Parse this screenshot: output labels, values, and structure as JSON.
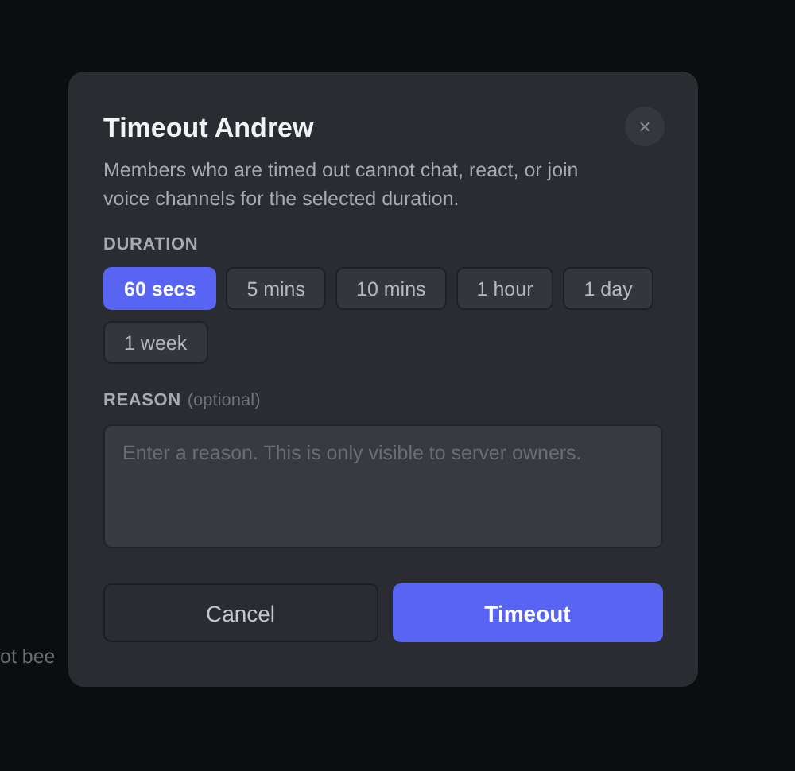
{
  "background_text": "ot bee",
  "dialog": {
    "title": "Timeout Andrew",
    "close": "×",
    "description": "Members who are timed out cannot chat, react, or join voice channels for the selected duration.",
    "duration_label": "DURATION",
    "durations": [
      {
        "label": "60 secs",
        "selected": true
      },
      {
        "label": "5 mins",
        "selected": false
      },
      {
        "label": "10 mins",
        "selected": false
      },
      {
        "label": "1 hour",
        "selected": false
      },
      {
        "label": "1 day",
        "selected": false
      },
      {
        "label": "1 week",
        "selected": false
      }
    ],
    "reason_label": "REASON",
    "reason_hint": "(optional)",
    "reason": {
      "placeholder": "Enter a reason. This is only visible to server owners."
    },
    "buttons": [
      {
        "label": "Cancel",
        "kind": "secondary"
      },
      {
        "label": "Timeout",
        "kind": "primary"
      }
    ]
  }
}
